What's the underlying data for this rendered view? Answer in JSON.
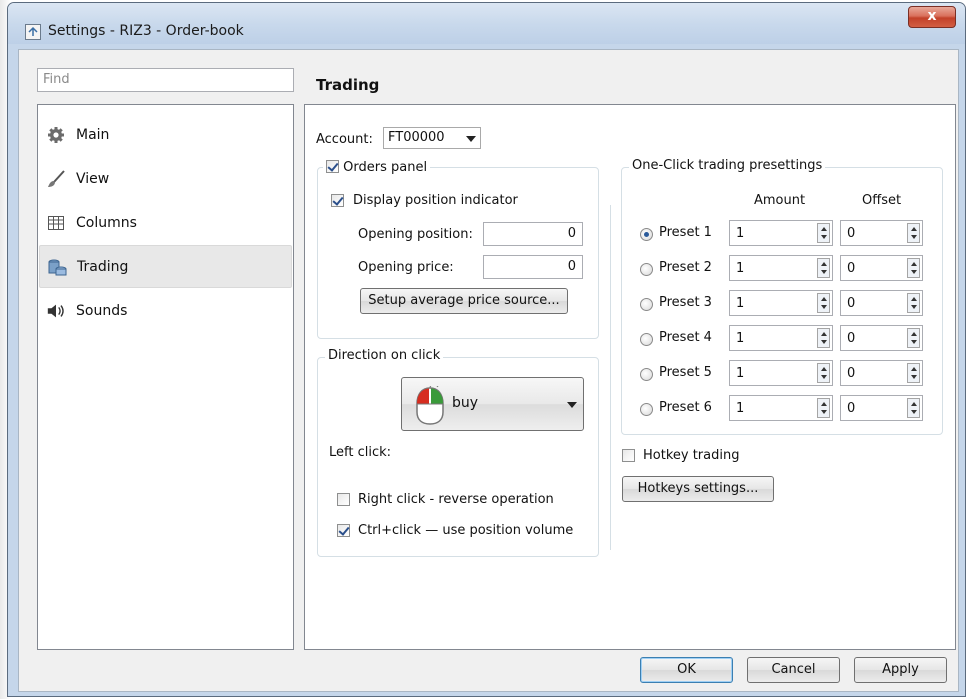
{
  "window": {
    "title": "Settings - RIZ3 - Order-book",
    "close_label": "x"
  },
  "sidebar": {
    "search_placeholder": "Find",
    "items": [
      {
        "label": "Main",
        "icon": "gear-icon"
      },
      {
        "label": "View",
        "icon": "brush-icon"
      },
      {
        "label": "Columns",
        "icon": "table-columns-icon"
      },
      {
        "label": "Trading",
        "icon": "coin-stack-icon",
        "selected": true
      },
      {
        "label": "Sounds",
        "icon": "speaker-icon"
      }
    ]
  },
  "main": {
    "heading": "Trading",
    "account": {
      "label": "Account:",
      "value": "FT00000"
    },
    "orders_panel": {
      "title": "Orders panel",
      "checked": true,
      "display_indicator": {
        "label": "Display position indicator",
        "checked": true
      },
      "opening_position": {
        "label": "Opening position:",
        "value": "0"
      },
      "opening_price": {
        "label": "Opening price:",
        "value": "0"
      },
      "setup_button": "Setup average price source..."
    },
    "direction": {
      "title": "Direction on click",
      "left_click_label": "Left click:",
      "left_click_value": "buy",
      "right_click": {
        "label": "Right click - reverse operation",
        "checked": false
      },
      "ctrl_click": {
        "label": "Ctrl+click — use position volume",
        "checked": true
      }
    },
    "presets": {
      "title": "One-Click trading presettings",
      "amount_header": "Amount",
      "offset_header": "Offset",
      "rows": [
        {
          "label": "Preset 1",
          "amount": "1",
          "offset": "0",
          "selected": true
        },
        {
          "label": "Preset 2",
          "amount": "1",
          "offset": "0",
          "selected": false
        },
        {
          "label": "Preset 3",
          "amount": "1",
          "offset": "0",
          "selected": false
        },
        {
          "label": "Preset 4",
          "amount": "1",
          "offset": "0",
          "selected": false
        },
        {
          "label": "Preset 5",
          "amount": "1",
          "offset": "0",
          "selected": false
        },
        {
          "label": "Preset 6",
          "amount": "1",
          "offset": "0",
          "selected": false
        }
      ]
    },
    "hotkey_trading": {
      "label": "Hotkey trading",
      "checked": false
    },
    "hotkeys_button": "Hotkeys settings..."
  },
  "footer": {
    "ok": "OK",
    "cancel": "Cancel",
    "apply": "Apply"
  },
  "colors": {
    "titlebar": "#c9d9ec",
    "close_button": "#c94a33",
    "selected_nav": "#e8e8e8",
    "default_button_border": "#3c7fb1"
  }
}
